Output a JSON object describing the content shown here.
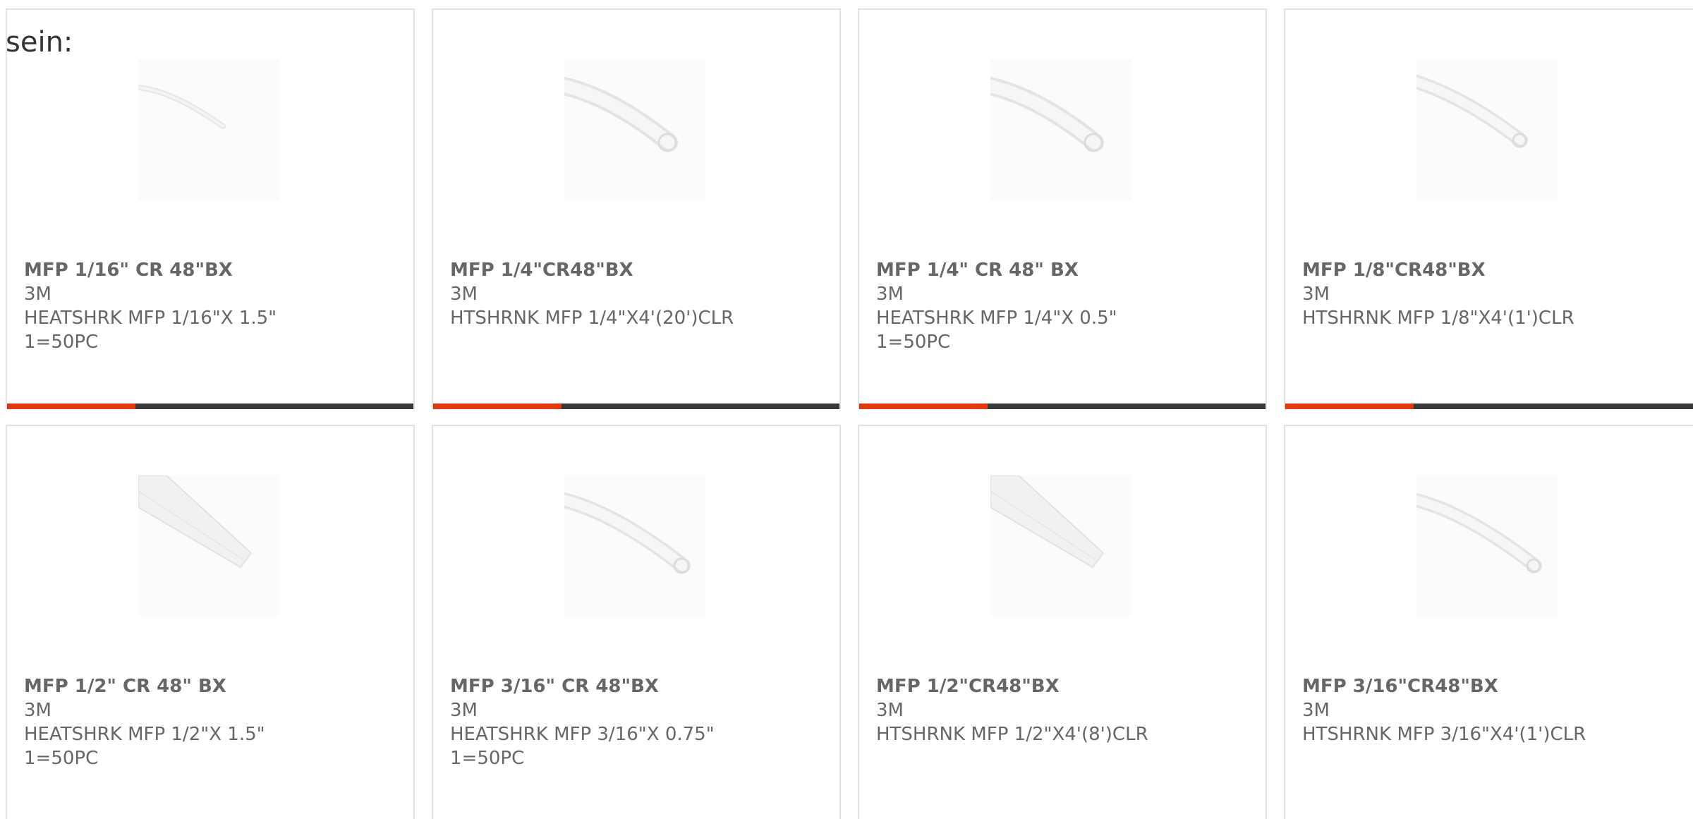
{
  "intro_text": "sein:",
  "colors": {
    "accent": "#e0380e",
    "bar_dark": "#3a3a3a",
    "card_border": "#e2e2e2",
    "text": "#666666"
  },
  "products": [
    {
      "name": "MFP 1/16\" CR 48\"BX",
      "brand": "3M",
      "desc": "HEATSHRK MFP 1/16\"X 1.5\"",
      "pack": "1=50PC",
      "image": "thin-tube"
    },
    {
      "name": "MFP 1/4\"CR48\"BX",
      "brand": "3M",
      "desc": "HTSHRNK MFP 1/4\"X4'(20')CLR",
      "pack": "",
      "image": "medium-tube"
    },
    {
      "name": "MFP 1/4\" CR 48\" BX",
      "brand": "3M",
      "desc": "HEATSHRK MFP 1/4\"X 0.5\"",
      "pack": "1=50PC",
      "image": "medium-tube"
    },
    {
      "name": "MFP 1/8\"CR48\"BX",
      "brand": "3M",
      "desc": "HTSHRNK MFP 1/8\"X4'(1')CLR",
      "pack": "",
      "image": "medium-tube"
    },
    {
      "name": "MFP 1/2\" CR 48\" BX",
      "brand": "3M",
      "desc": "HEATSHRK MFP 1/2\"X 1.5\"",
      "pack": "1=50PC",
      "image": "flat-tube"
    },
    {
      "name": "MFP 3/16\" CR 48\"BX",
      "brand": "3M",
      "desc": "HEATSHRK MFP 3/16\"X 0.75\"",
      "pack": "1=50PC",
      "image": "medium-tube"
    },
    {
      "name": "MFP 1/2\"CR48\"BX",
      "brand": "3M",
      "desc": "HTSHRNK MFP 1/2\"X4'(8')CLR",
      "pack": "",
      "image": "flat-tube"
    },
    {
      "name": "MFP 3/16\"CR48\"BX",
      "brand": "3M",
      "desc": "HTSHRNK MFP 3/16\"X4'(1')CLR",
      "pack": "",
      "image": "medium-tube"
    }
  ]
}
